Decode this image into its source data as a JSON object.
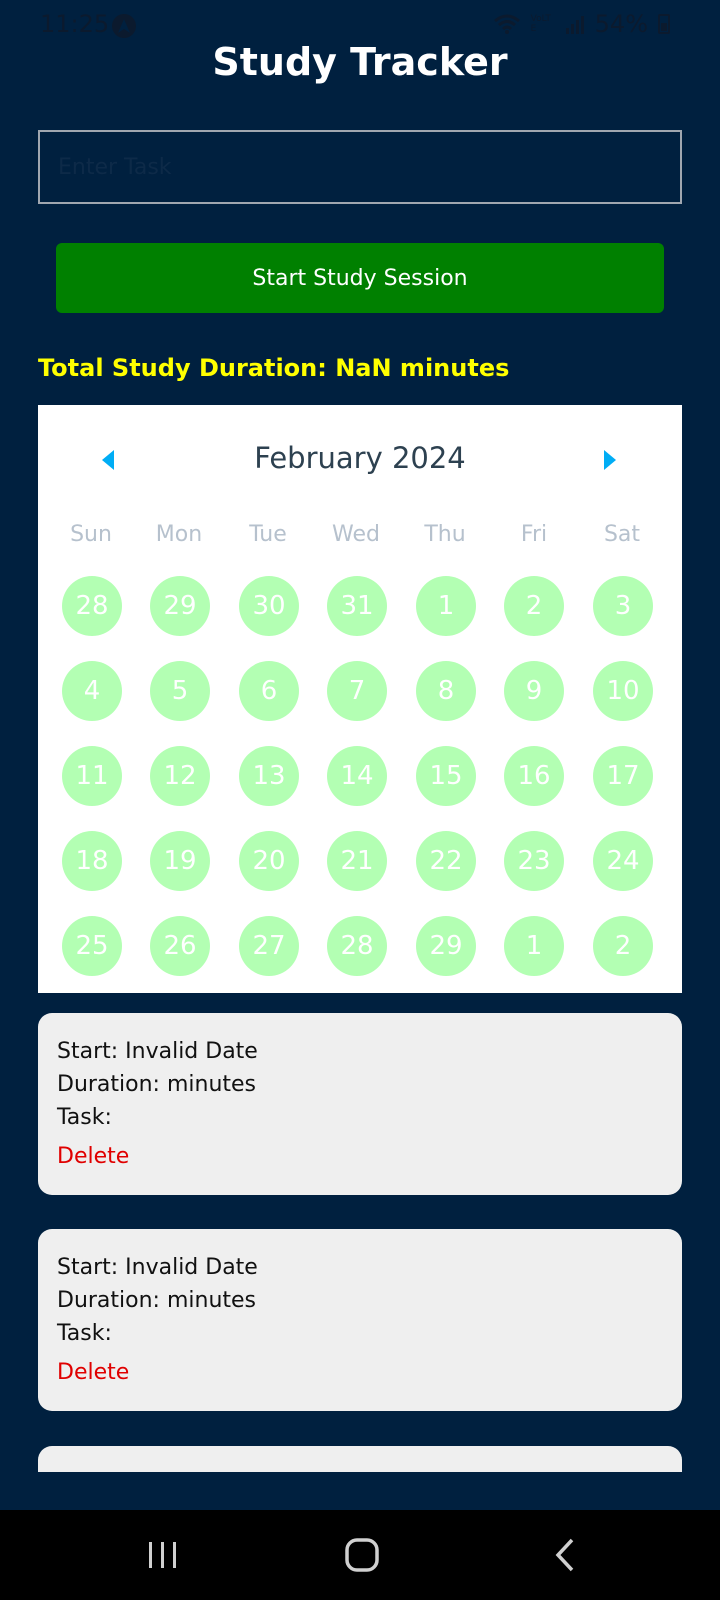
{
  "status_bar": {
    "time": "11:25",
    "network_label": "VoLTE",
    "battery": "54%"
  },
  "app": {
    "title": "Study Tracker",
    "task_placeholder": "Enter Task",
    "start_button_label": "Start Study Session",
    "total_duration_text": "Total Study Duration: NaN minutes"
  },
  "calendar": {
    "month_label": "February 2024",
    "weekdays": [
      "Sun",
      "Mon",
      "Tue",
      "Wed",
      "Thu",
      "Fri",
      "Sat"
    ],
    "weeks": [
      [
        "28",
        "29",
        "30",
        "31",
        "1",
        "2",
        "3"
      ],
      [
        "4",
        "5",
        "6",
        "7",
        "8",
        "9",
        "10"
      ],
      [
        "11",
        "12",
        "13",
        "14",
        "15",
        "16",
        "17"
      ],
      [
        "18",
        "19",
        "20",
        "21",
        "22",
        "23",
        "24"
      ],
      [
        "25",
        "26",
        "27",
        "28",
        "29",
        "1",
        "2"
      ]
    ],
    "marked_color": "#b3ffb3",
    "arrow_color": "#00adf5"
  },
  "sessions": [
    {
      "start": "Start: Invalid Date",
      "duration": "Duration:  minutes",
      "task": "Task:",
      "delete_label": "Delete"
    },
    {
      "start": "Start: Invalid Date",
      "duration": "Duration:  minutes",
      "task": "Task:",
      "delete_label": "Delete"
    }
  ],
  "colors": {
    "background": "#00203f",
    "button_green": "#008000",
    "total_duration_yellow": "#ffff00",
    "delete_red": "#e00000",
    "card_background": "#efefef"
  }
}
